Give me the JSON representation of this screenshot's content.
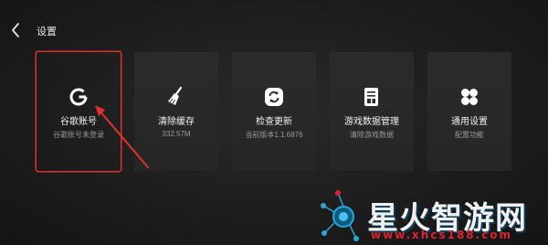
{
  "header": {
    "title": "设置",
    "back_icon": "chevron-left-icon"
  },
  "cards": [
    {
      "label": "谷歌账号",
      "sub": "谷歌账号未登录",
      "icon": "google-icon",
      "selected": true
    },
    {
      "label": "清除缓存",
      "sub": "332.57M",
      "icon": "broom-icon"
    },
    {
      "label": "检查更新",
      "sub": "当前版本1.1.6876",
      "icon": "refresh-icon"
    },
    {
      "label": "游戏数据管理",
      "sub": "清除游戏数据",
      "icon": "data-sheet-icon"
    },
    {
      "label": "通用设置",
      "sub": "配置功能",
      "icon": "four-petal-icon"
    }
  ],
  "annotation": {
    "color": "#e03131"
  },
  "watermark": {
    "text": "星火智游网",
    "url": "www.xhcs188.com"
  }
}
